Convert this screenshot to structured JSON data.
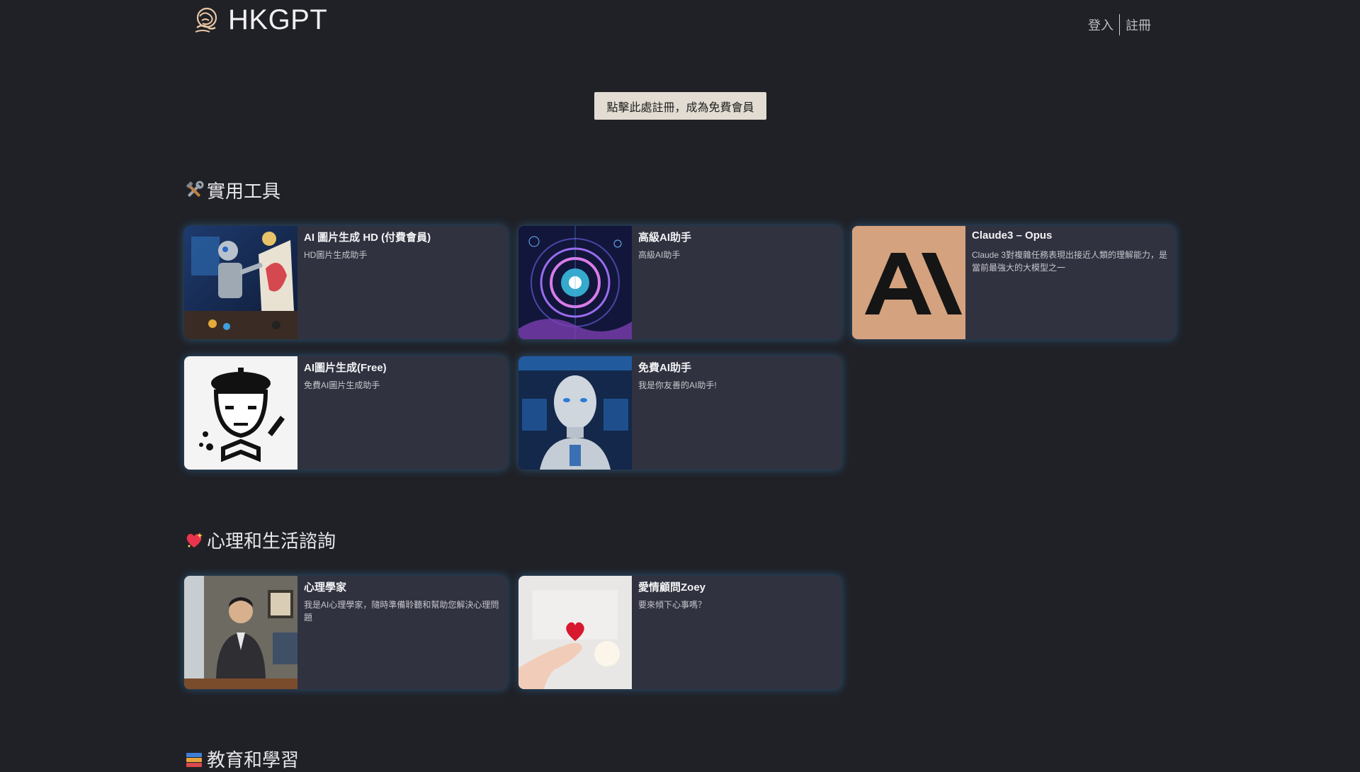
{
  "header": {
    "brand": "HKGPT",
    "login": "登入",
    "register": "註冊"
  },
  "cta": {
    "label": "點擊此處註冊，成為免費會員"
  },
  "sections": [
    {
      "title": "實用工具",
      "icon": "tools-icon",
      "cards": [
        {
          "title": "AI 圖片生成 HD (付費會員)",
          "desc": "HD圖片生成助手",
          "thumb": "robot-painter-image"
        },
        {
          "title": "高級AI助手",
          "desc": "高級AI助手",
          "thumb": "cosmic-orb-image"
        },
        {
          "title": "Claude3 – Opus",
          "desc": "Claude 3對複雜任務表現出接近人類的理解能力，是當前最強大的大模型之一",
          "thumb": "anthropic-logo",
          "thumb_bg": "#d4a27f"
        },
        {
          "title": "AI圖片生成(Free)",
          "desc": "免費AI圖片生成助手",
          "thumb": "artist-mask-icon"
        },
        {
          "title": "免費AI助手",
          "desc": "我是你友善的AI助手!",
          "thumb": "silver-robot-image"
        }
      ]
    },
    {
      "title": "心理和生活諮詢",
      "icon": "heart-sparkle-icon",
      "cards": [
        {
          "title": "心理學家",
          "desc": "我是AI心理學家，隨時準備聆聽和幫助您解決心理問題",
          "thumb": "psychologist-photo"
        },
        {
          "title": "愛情顧問Zoey",
          "desc": "要來傾下心事嗎？",
          "thumb": "heart-hand-photo"
        }
      ]
    },
    {
      "title": "教育和學習",
      "icon": "books-icon"
    }
  ],
  "colors": {
    "background": "#202127",
    "card": "#303240",
    "glow": "#3696dc",
    "cta": "#e2dcd2"
  }
}
